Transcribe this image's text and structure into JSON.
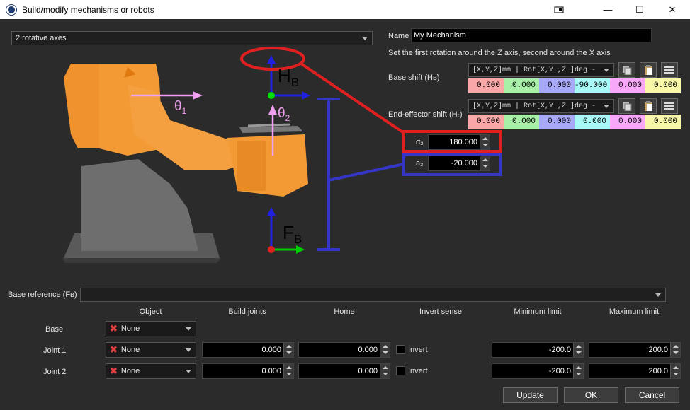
{
  "window": {
    "title": "Build/modify mechanisms or robots",
    "minimize": "—",
    "maximize": "☐",
    "close": "✕"
  },
  "mechanism_type": {
    "value": "2 rotative axes"
  },
  "name": {
    "label": "Name",
    "value": "My Mechanism"
  },
  "instruction": "Set the first rotation around the Z axis, second around the X axis",
  "base_shift": {
    "label": "Base shift (Hʙ)",
    "format": "[X,Y,Z]mm | Rot[X,Y ,Z  ]deg -",
    "values": [
      "0.000",
      "0.000",
      "0.000",
      "-90.000",
      "0.000",
      "0.000"
    ]
  },
  "effector_shift": {
    "label": "End-effector shift (Hₜ)",
    "format": "[X,Y,Z]mm | Rot[X,Y ,Z  ]deg -",
    "values": [
      "0.000",
      "0.000",
      "0.000",
      "0.000",
      "0.000",
      "0.000"
    ]
  },
  "alpha2": {
    "label": "α₂",
    "value": "180.000"
  },
  "a2": {
    "label": "a₂",
    "value": "-20.000"
  },
  "diagram": {
    "theta1": "θ",
    "theta1_sub": "1",
    "theta2": "θ",
    "theta2_sub": "2",
    "FB": "F",
    "FB_sub": "B",
    "HB": "H",
    "HB_sub": "B"
  },
  "base_reference": {
    "label": "Base reference (Fʙ)",
    "value": ""
  },
  "table": {
    "headers": [
      "Object",
      "Build joints",
      "Home",
      "Invert sense",
      "Minimum limit",
      "Maximum limit"
    ],
    "rows": [
      {
        "label": "Base",
        "object": "None"
      },
      {
        "label": "Joint 1",
        "object": "None",
        "build": "0.000",
        "home": "0.000",
        "invert": "Invert",
        "min": "-200.0",
        "max": "200.0"
      },
      {
        "label": "Joint 2",
        "object": "None",
        "build": "0.000",
        "home": "0.000",
        "invert": "Invert",
        "min": "-200.0",
        "max": "200.0"
      }
    ]
  },
  "buttons": {
    "update": "Update",
    "ok": "OK",
    "cancel": "Cancel"
  },
  "colors": {
    "x": "#f9a7a7",
    "y": "#a8f0a8",
    "z": "#a8a8f8",
    "rx": "#a8f8f8",
    "ry": "#f8a8f8",
    "rz": "#f8f8a8"
  }
}
